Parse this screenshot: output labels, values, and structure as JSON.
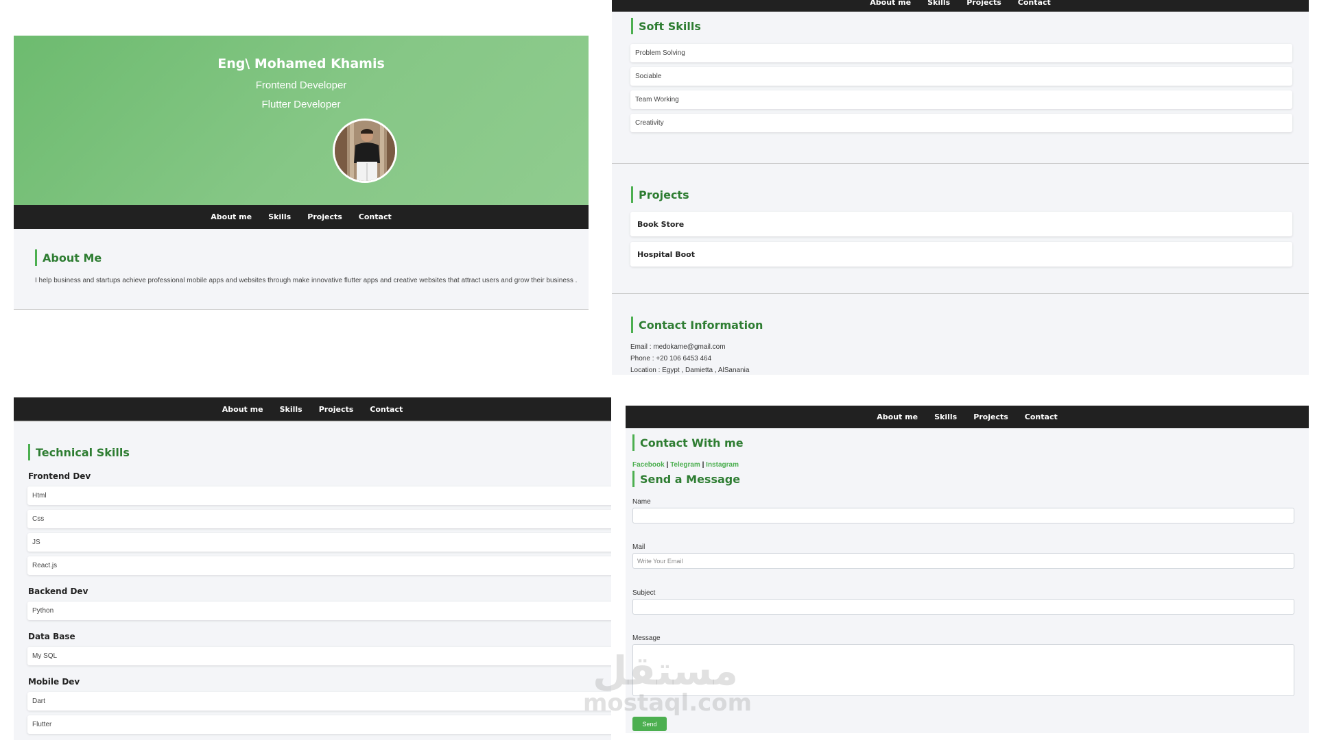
{
  "nav": {
    "about": "About me",
    "skills": "Skills",
    "projects": "Projects",
    "contact": "Contact"
  },
  "hero": {
    "name": "Eng\\ Mohamed Khamis",
    "role1": "Frontend Developer",
    "role2": "Flutter Developer"
  },
  "about": {
    "title": "About Me",
    "text": "I help business and startups achieve professional mobile apps and websites through make innovative flutter apps and creative websites that attract users and grow their business ."
  },
  "soft_skills": {
    "title": "Soft Skills",
    "items": [
      "Problem Solving",
      "Sociable",
      "Team Working",
      "Creativity"
    ]
  },
  "projects": {
    "title": "Projects",
    "items": [
      "Book Store",
      "Hospital Boot"
    ]
  },
  "contact_info": {
    "title": "Contact Information",
    "email": "Email : medokame@gmail.com",
    "phone": "Phone : +20 106 6453 464",
    "location": "Location : Egypt , Damietta , AlSanania"
  },
  "technical_skills": {
    "title": "Technical Skills",
    "frontend": {
      "label": "Frontend Dev",
      "items": [
        "Html",
        "Css",
        "JS",
        "React.js"
      ]
    },
    "backend": {
      "label": "Backend Dev",
      "items": [
        "Python"
      ]
    },
    "database": {
      "label": "Data Base",
      "items": [
        "My SQL"
      ]
    },
    "mobile": {
      "label": "Mobile Dev",
      "items": [
        "Dart",
        "Flutter"
      ]
    }
  },
  "contact_form": {
    "title": "Contact With me",
    "social": {
      "facebook": "Facebook",
      "sep1": "|",
      "telegram": "Telegram",
      "sep2": "|",
      "instagram": "Instagram"
    },
    "send_title": "Send a Message",
    "name_label": "Name",
    "mail_label": "Mail",
    "mail_placeholder": "Write Your Email",
    "subject_label": "Subject",
    "message_label": "Message",
    "send_button": "Send"
  },
  "watermark": {
    "arabic": "مستقل",
    "latin": "mostaql.com"
  },
  "colors": {
    "accent": "#4caf50",
    "heading": "#2e7d32",
    "nav": "#212121",
    "hero_start": "#6dbb6f",
    "hero_end": "#8fcc8f"
  }
}
